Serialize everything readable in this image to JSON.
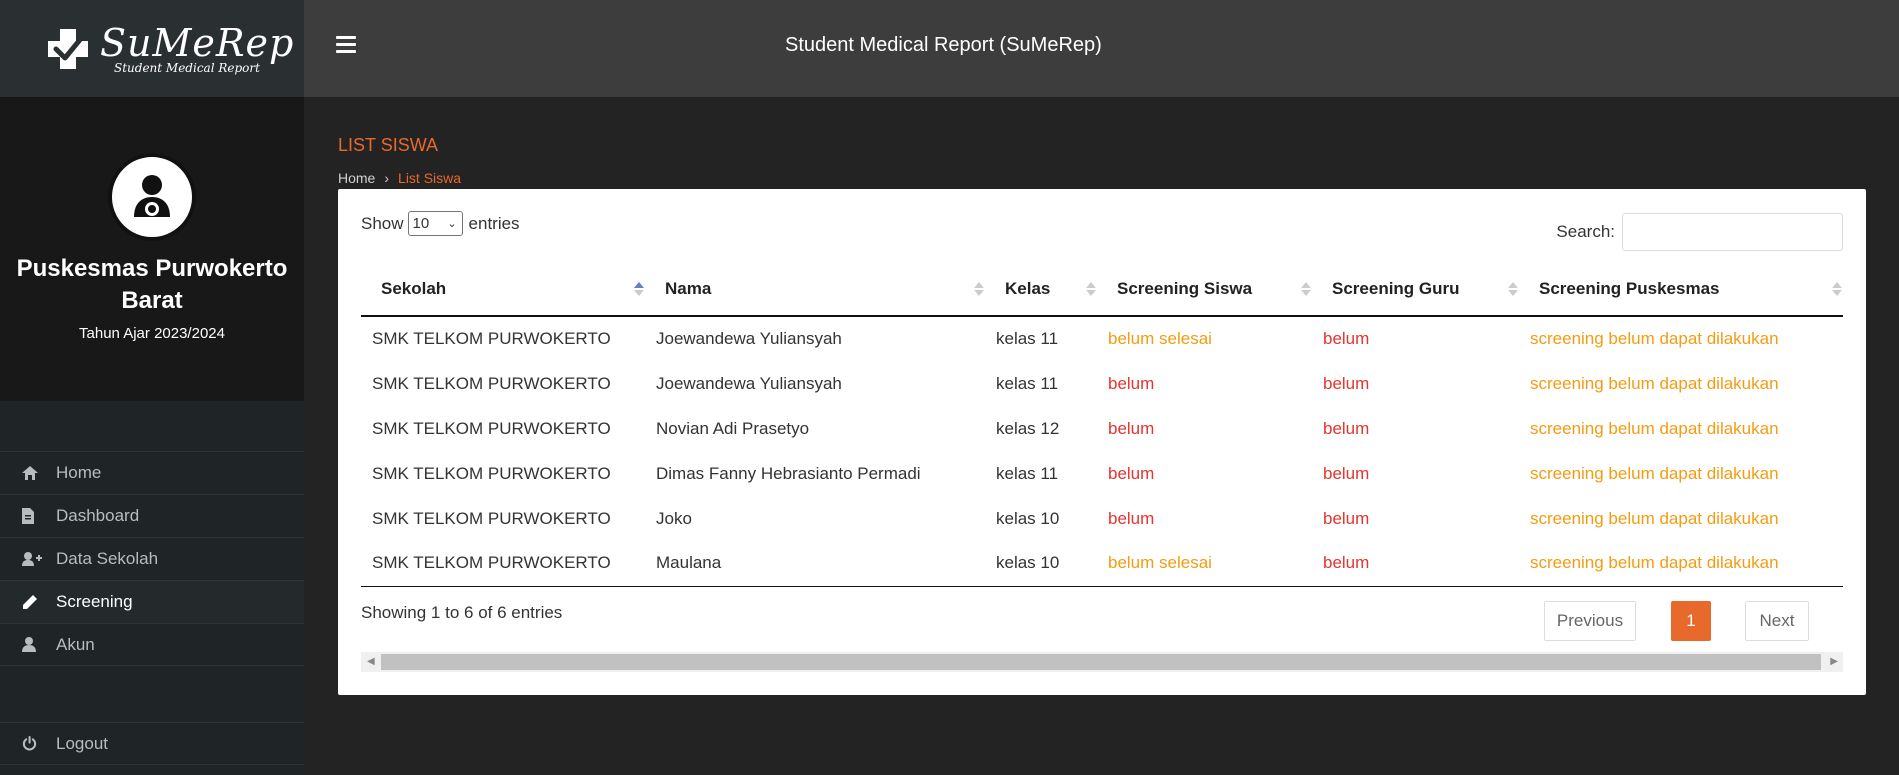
{
  "brand": {
    "name": "SuMeRep",
    "subtitle": "Student Medical Report"
  },
  "profile": {
    "name": "Puskesmas Purwokerto Barat",
    "year": "Tahun Ajar 2023/2024"
  },
  "nav": [
    {
      "label": "Home",
      "icon": "home-icon"
    },
    {
      "label": "Dashboard",
      "icon": "file-icon"
    },
    {
      "label": "Data Sekolah",
      "icon": "user-plus-icon"
    },
    {
      "label": "Screening",
      "icon": "pencil-icon",
      "active": true
    },
    {
      "label": "Akun",
      "icon": "user-icon"
    }
  ],
  "logout": {
    "label": "Logout",
    "icon": "power-icon"
  },
  "topbar": {
    "title": "Student Medical Report (SuMeRep)"
  },
  "page": {
    "title": "LIST SISWA",
    "breadcrumb_home": "Home",
    "breadcrumb_current": "List Siswa"
  },
  "table_controls": {
    "show_label": "Show",
    "show_value": "10",
    "entries_label": "entries",
    "search_label": "Search:"
  },
  "table": {
    "columns": [
      "Sekolah",
      "Nama",
      "Kelas",
      "Screening Siswa",
      "Screening Guru",
      "Screening Puskesmas"
    ],
    "rows": [
      [
        "SMK TELKOM PURWOKERTO",
        "Joewandewa Yuliansyah",
        "kelas 11",
        "belum selesai",
        "belum",
        "screening belum dapat dilakukan"
      ],
      [
        "SMK TELKOM PURWOKERTO",
        "Joewandewa Yuliansyah",
        "kelas 11",
        "belum",
        "belum",
        "screening belum dapat dilakukan"
      ],
      [
        "SMK TELKOM PURWOKERTO",
        "Novian Adi Prasetyo",
        "kelas 12",
        "belum",
        "belum",
        "screening belum dapat dilakukan"
      ],
      [
        "SMK TELKOM PURWOKERTO",
        "Dimas Fanny Hebrasianto Permadi",
        "kelas 11",
        "belum",
        "belum",
        "screening belum dapat dilakukan"
      ],
      [
        "SMK TELKOM PURWOKERTO",
        "Joko",
        "kelas 10",
        "belum",
        "belum",
        "screening belum dapat dilakukan"
      ],
      [
        "SMK TELKOM PURWOKERTO",
        "Maulana",
        "kelas 10",
        "belum selesai",
        "belum",
        "screening belum dapat dilakukan"
      ]
    ]
  },
  "footer": {
    "info": "Showing 1 to 6 of 6 entries",
    "previous": "Previous",
    "page": "1",
    "next": "Next"
  },
  "colors": {
    "accent": "#e8692c",
    "status_orange": "#f39c12",
    "status_red": "#e3342f"
  }
}
